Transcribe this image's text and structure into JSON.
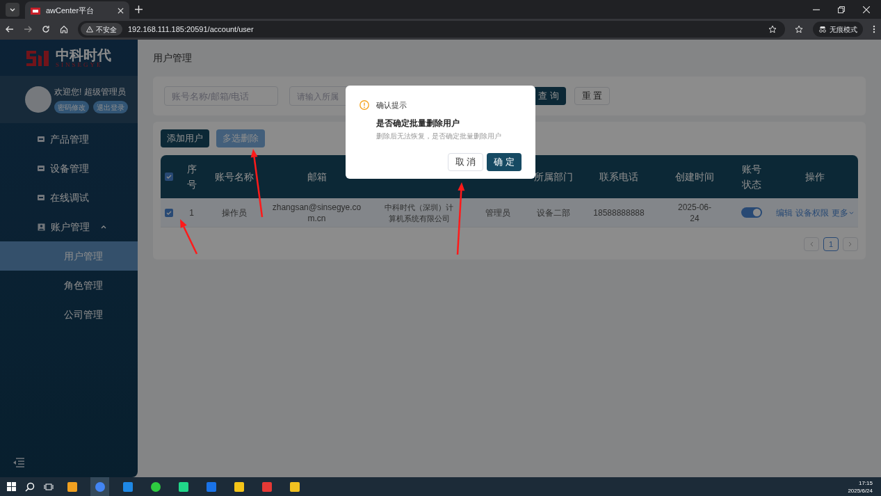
{
  "browser": {
    "tab_title": "awCenter平台",
    "security": "不安全",
    "url": "192.168.111.185:20591/account/user",
    "incognito": "无痕模式"
  },
  "sidebar": {
    "brand": "中科时代",
    "brand_sub": "SINSEGYE",
    "welcome": "欢迎您! 超级管理员",
    "user_buttons": [
      "密码修改",
      "退出登录"
    ],
    "menu": [
      {
        "label": "产品管理"
      },
      {
        "label": "设备管理"
      },
      {
        "label": "在线调试"
      },
      {
        "label": "账户管理",
        "expanded": true,
        "children": [
          {
            "label": "用户管理",
            "selected": true
          },
          {
            "label": "角色管理",
            "selected": false
          },
          {
            "label": "公司管理",
            "selected": false
          }
        ]
      }
    ]
  },
  "page_title": "用户管理",
  "search": {
    "fields": [
      {
        "placeholder": "账号名称/邮箱/电话"
      },
      {
        "placeholder": "请输入所属"
      }
    ],
    "buttons": [
      "查 询",
      "重 置"
    ]
  },
  "actions": [
    {
      "label": "添加用户",
      "disabled": false
    },
    {
      "label": "多选删除",
      "disabled": true
    }
  ],
  "table": {
    "all_checked": true,
    "columns": [
      "序号",
      "账号名称",
      "邮箱",
      "",
      "",
      "所属部门",
      "联系电话",
      "创建时间",
      "账号状态",
      "操作"
    ],
    "rows": [
      {
        "checked": true,
        "cells": [
          "1",
          "操作员",
          "zhangsan@sinsegye.com.cn",
          "中科时代（深圳）计算机系统有限公司",
          "管理员",
          "设备二部",
          "18588888888",
          "2025-06-24"
        ],
        "status_on": true,
        "ops": [
          "编辑",
          "设备权限",
          "更多"
        ]
      }
    ]
  },
  "pagination": {
    "pages": [
      {
        "label": "1",
        "selected": true
      }
    ]
  },
  "dialog": {
    "title": "确认提示",
    "heading": "是否确定批量删除用户",
    "message": "删除后无法恢复，是否确定批量删除用户",
    "buttons": [
      "取 消",
      "确 定"
    ]
  },
  "taskbar": {
    "time": "17:15",
    "date": "2025/6/24"
  }
}
